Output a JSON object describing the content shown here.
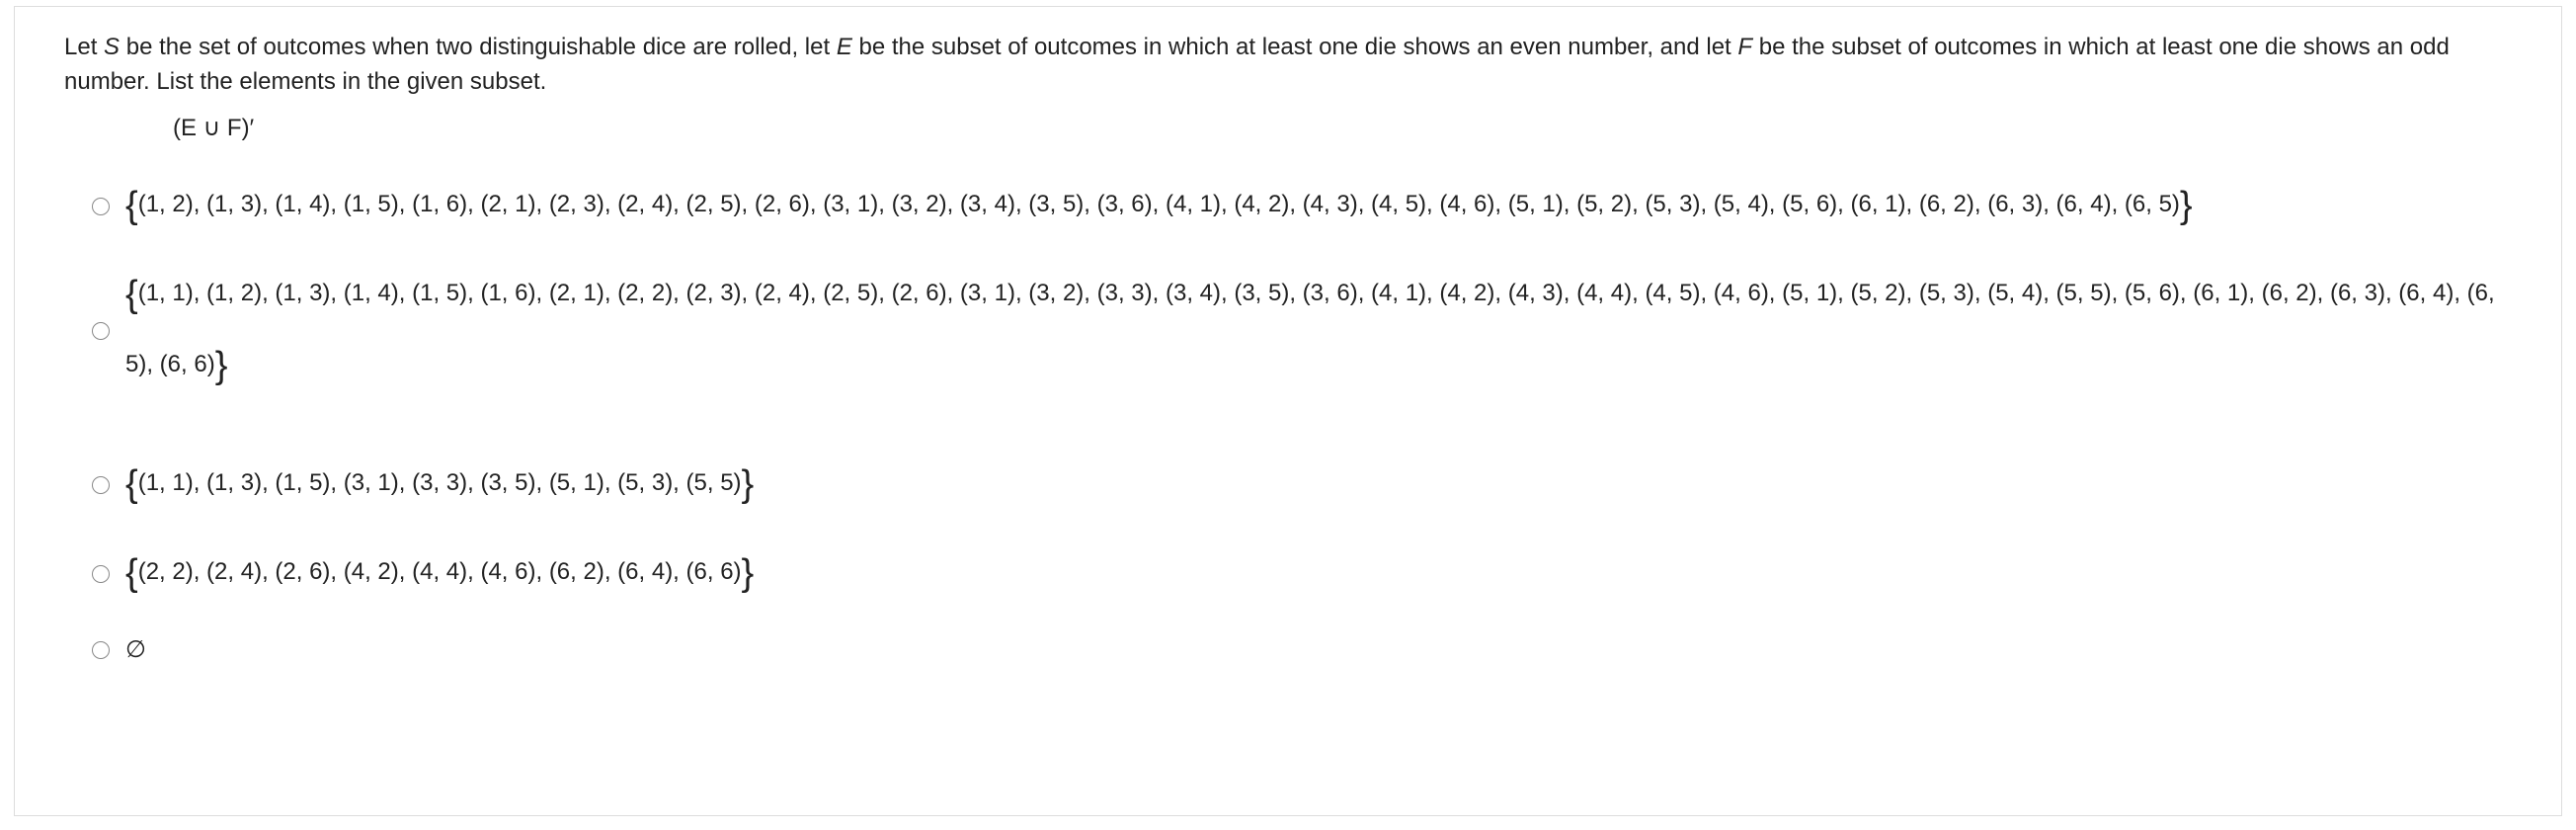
{
  "question": {
    "line1_pre": "Let ",
    "var_S": "S",
    "line1_mid1": " be the set of outcomes when two distinguishable dice are rolled, let ",
    "var_E": "E",
    "line1_mid2": " be the subset of outcomes in which at least one die shows an even number, and let ",
    "var_F": "F",
    "line1_end": " be the subset of outcomes in which at least one die shows an odd number. List the elements in the given subset.",
    "subset_label": "(E ∪ F)′"
  },
  "choices": {
    "a": "(1, 2), (1, 3), (1, 4), (1, 5), (1, 6), (2, 1), (2, 3), (2, 4), (2, 5), (2, 6), (3, 1), (3, 2), (3, 4), (3, 5), (3, 6), (4, 1), (4, 2), (4, 3), (4, 5), (4, 6), (5, 1), (5, 2), (5, 3), (5, 4), (5, 6), (6, 1), (6, 2), (6, 3), (6, 4), (6, 5)",
    "b": "(1, 1), (1, 2), (1, 3), (1, 4), (1, 5), (1, 6), (2, 1), (2, 2), (2, 3), (2, 4), (2, 5), (2, 6), (3, 1), (3, 2), (3, 3), (3, 4), (3, 5), (3, 6), (4, 1), (4, 2), (4, 3), (4, 4), (4, 5), (4, 6), (5, 1), (5, 2), (5, 3), (5, 4), (5, 5), (5, 6), (6, 1), (6, 2), (6, 3), (6, 4), (6, 5), (6, 6)",
    "c": "(1, 1), (1, 3), (1, 5), (3, 1), (3, 3), (3, 5), (5, 1), (5, 3), (5, 5)",
    "d": "(2, 2), (2, 4), (2, 6), (4, 2), (4, 4), (4, 6), (6, 2), (6, 4), (6, 6)",
    "e": "∅"
  }
}
